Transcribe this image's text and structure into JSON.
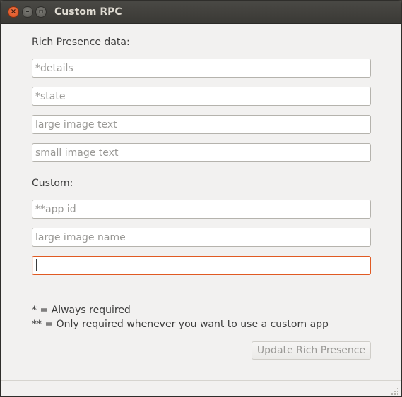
{
  "window": {
    "title": "Custom RPC",
    "close_glyph": "×",
    "minimize_glyph": "–",
    "maximize_glyph": "▫"
  },
  "sections": {
    "rich_presence_label": "Rich Presence data:",
    "custom_label": "Custom:"
  },
  "fields": {
    "details": {
      "placeholder": "*details",
      "value": ""
    },
    "state": {
      "placeholder": "*state",
      "value": ""
    },
    "large_image_text": {
      "placeholder": "large image text",
      "value": ""
    },
    "small_image_text": {
      "placeholder": "small image text",
      "value": ""
    },
    "app_id": {
      "placeholder": "**app id",
      "value": ""
    },
    "large_image_name": {
      "placeholder": "large image name",
      "value": ""
    },
    "small_image_name": {
      "placeholder": "",
      "value": ""
    }
  },
  "notes": {
    "always_required": "* = Always required",
    "custom_required": "** = Only required whenever you want to use a custom app"
  },
  "buttons": {
    "update": "Update Rich Presence"
  },
  "colors": {
    "focus_border": "#e05a23",
    "close_button": "#e0541f",
    "background": "#f2f1f0"
  }
}
